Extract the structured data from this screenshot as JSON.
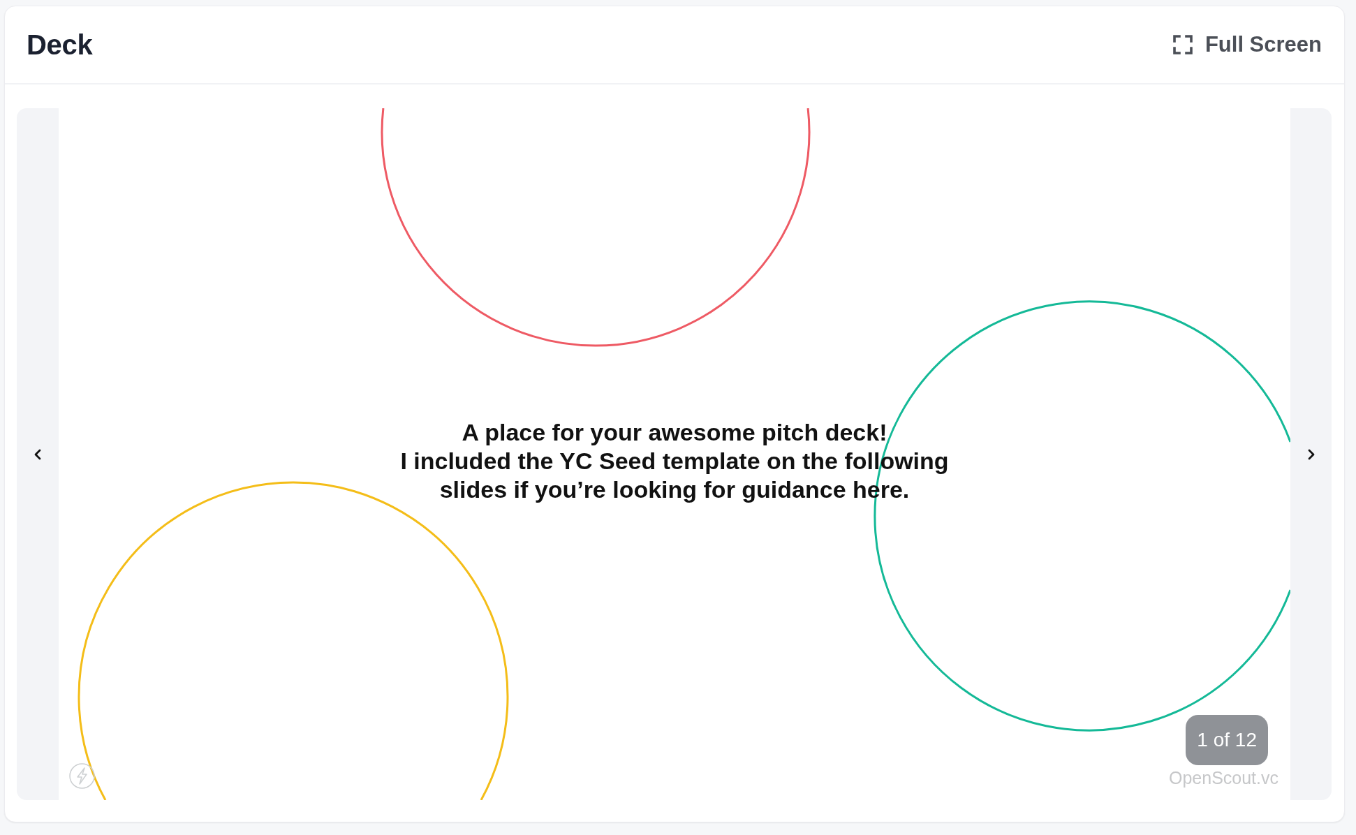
{
  "header": {
    "title": "Deck",
    "full_screen_button": {
      "label": "Full Screen"
    }
  },
  "slide": {
    "text": "A place for your awesome pitch deck!\nI included the YC Seed template on the following\nslides if you’re looking for guidance here.",
    "footer": "OpenScout.vc"
  },
  "pagination": {
    "label": "1 of 12"
  }
}
